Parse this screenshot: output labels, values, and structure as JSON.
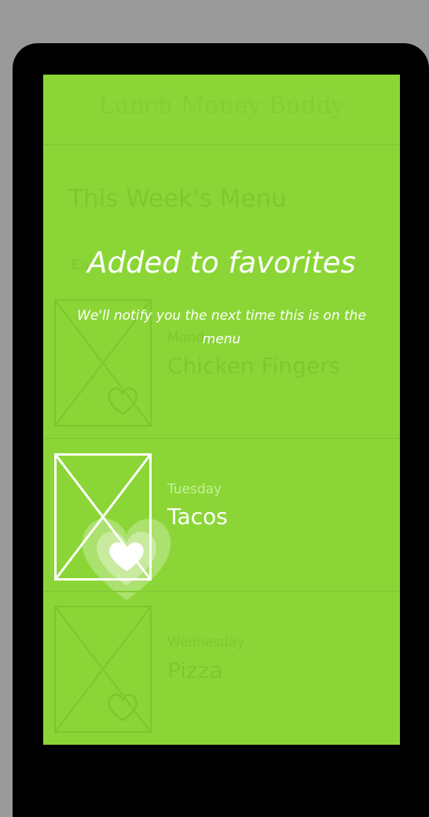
{
  "app": {
    "title": "Lunch Money Buddy"
  },
  "menu": {
    "heading": "This Week's Menu",
    "hidden_label": "Ea",
    "days": [
      {
        "day": "Monday",
        "dish": "Chicken Fingers"
      },
      {
        "day": "Tuesday",
        "dish": "Tacos"
      },
      {
        "day": "Wednesday",
        "dish": "Pizza"
      }
    ]
  },
  "toast": {
    "title": "Added to favorites",
    "message": "We'll notify you the next time this is on the menu"
  },
  "colors": {
    "background": "#8bd636",
    "faded_text": "#7fc72f",
    "overlay_text": "#ffffff",
    "frame": "#000000"
  },
  "icons": [
    "placeholder-image-icon",
    "heart-icon"
  ]
}
